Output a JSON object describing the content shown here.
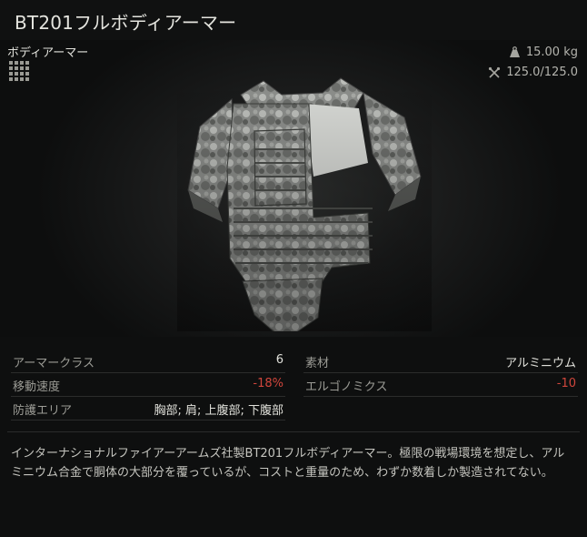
{
  "item": {
    "title": "BT201フルボディアーマー",
    "category": "ボディアーマー",
    "weight": "15.00 kg",
    "durability": "125.0/125.0"
  },
  "icons": {
    "category": "grid-icon",
    "weight": "weight-icon",
    "durability": "wrench-icon"
  },
  "properties_left": [
    {
      "label": "アーマークラス",
      "value": "6"
    },
    {
      "label": "移動速度",
      "value": "-18%"
    },
    {
      "label": "防護エリア",
      "value": "胸部; 肩; 上腹部; 下腹部"
    }
  ],
  "properties_right": [
    {
      "label": "素材",
      "value": "アルミニウム"
    },
    {
      "label": "エルゴノミクス",
      "value": "-10"
    }
  ],
  "description": "インターナショナルファイアーアームズ社製BT201フルボディアーマー。極限の戦場環境を想定し、アルミニウム合金で胴体の大部分を覆っているが、コストと重量のため、わずか数着しか製造されてない。",
  "colors": {
    "negative": "#d0463c",
    "text": "#e0e0da",
    "label": "#9c9c96"
  }
}
